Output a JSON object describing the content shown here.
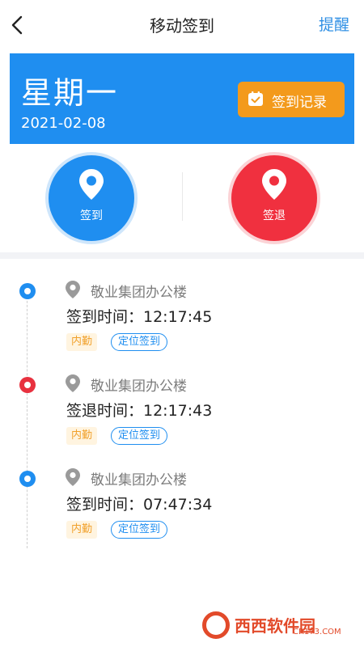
{
  "nav": {
    "back_icon": "chevron-left-icon",
    "title": "移动签到",
    "remind": "提醒"
  },
  "banner": {
    "weekday": "星期一",
    "date": "2021-02-08",
    "record_button": "签到记录",
    "record_icon": "calendar-check-icon",
    "background_color": "#1f8ef0",
    "button_color": "#f39a1c"
  },
  "actions": {
    "check_in": {
      "label": "签到",
      "icon": "location-pin-icon",
      "color": "#1f8ef0"
    },
    "check_out": {
      "label": "签退",
      "icon": "location-pin-icon",
      "color": "#f0303f"
    }
  },
  "records": [
    {
      "status": "check-in",
      "dot_color": "#1f8ef0",
      "location": "敬业集团办公楼",
      "time_text": "签到时间：12:17:45",
      "tag_type": "内勤",
      "tag_method": "定位签到"
    },
    {
      "status": "check-out",
      "dot_color": "#e8313f",
      "location": "敬业集团办公楼",
      "time_text": "签退时间：12:17:43",
      "tag_type": "内勤",
      "tag_method": "定位签到"
    },
    {
      "status": "check-in",
      "dot_color": "#1f8ef0",
      "location": "敬业集团办公楼",
      "time_text": "签到时间：07:47:34",
      "tag_type": "内勤",
      "tag_method": "定位签到"
    }
  ],
  "watermark": {
    "brand": "西西软件园",
    "site": "CR173.COM"
  }
}
